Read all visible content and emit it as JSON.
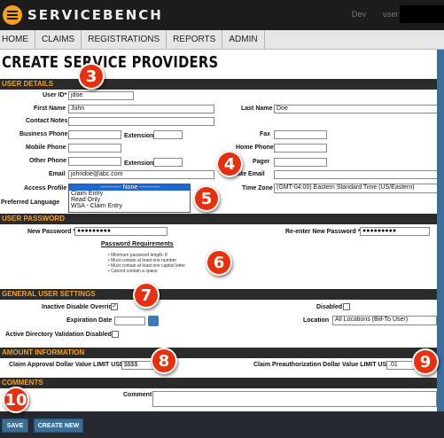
{
  "header": {
    "logo_text": "SERVICEBENCH",
    "env_label": "Dev",
    "user_label": "user"
  },
  "nav": {
    "items": [
      "HOME",
      "CLAIMS",
      "REGISTRATIONS",
      "REPORTS",
      "ADMIN"
    ]
  },
  "page_title": "CREATE SERVICE PROVIDERS",
  "sections": {
    "user_details": "USER DETAILS",
    "user_password": "USER PASSWORD",
    "general_settings": "GENERAL USER SETTINGS",
    "amount_info": "AMOUNT INFORMATION",
    "comments": "COMMENTS"
  },
  "user_details": {
    "user_id_label": "User ID*",
    "user_id_value": "jdoe",
    "first_name_label": "First Name",
    "first_name_value": "John",
    "last_name_label": "Last Name",
    "last_name_value": "Doe",
    "contact_notes_label": "Contact Notes",
    "business_phone_label": "Business Phone",
    "extension_label": "Extension",
    "fax_label": "Fax",
    "mobile_phone_label": "Mobile Phone",
    "home_phone_label": "Home Phone",
    "other_phone_label": "Other Phone",
    "extension2_label": "Extension",
    "pager_label": "Pager",
    "email_label": "Email",
    "email_value": "johndoe@abc.com",
    "alternate_email_label": "ate Email",
    "access_profile_label": "Access Profile",
    "preferred_language_label": "Preferred Language",
    "time_zone_label": "Time Zone",
    "time_zone_value": "(GMT-04:00) Eastern Standard Time (US/Eastern)",
    "access_profile_options": [
      "---------- None ----------",
      "Claim Entry",
      "Read Only",
      "WSA - Claim Entry"
    ]
  },
  "password": {
    "new_password_label": "New Password *",
    "new_password_value": "●●●●●●●●●",
    "reenter_label": "Re-enter New Password *",
    "reenter_value": "●●●●●●●●●",
    "requirements_title": "Password Requirements",
    "requirements": [
      "Minimum password length: 8",
      "Must contain at least one number",
      "Must contain at least one capital letter",
      "Cannot contain a space"
    ]
  },
  "general": {
    "inactive_override_label": "Inactive Disable Override",
    "inactive_override_checked": true,
    "disabled_label": "Disabled",
    "expiration_label": "Expiration Date",
    "location_label": "Location",
    "location_value": "All Locations (Bill-To User)",
    "ad_validation_label": "Active Directory Validation Disabled"
  },
  "amount": {
    "approval_label": "Claim Approval Dollar Value LIMIT USD",
    "approval_value": "$$$$",
    "preauth_label": "Claim Preauthorization Dollar Value LIMIT USD",
    "preauth_value": ".01"
  },
  "comments": {
    "comment_label": "Comment"
  },
  "buttons": {
    "save": "SAVE",
    "create_new": "CREATE NEW"
  },
  "badges": [
    "3",
    "4",
    "5",
    "6",
    "7",
    "8",
    "9",
    "10"
  ],
  "colors": {
    "accent": "#f4a11c",
    "badge": "#e8300f",
    "button": "#3a6e97"
  }
}
